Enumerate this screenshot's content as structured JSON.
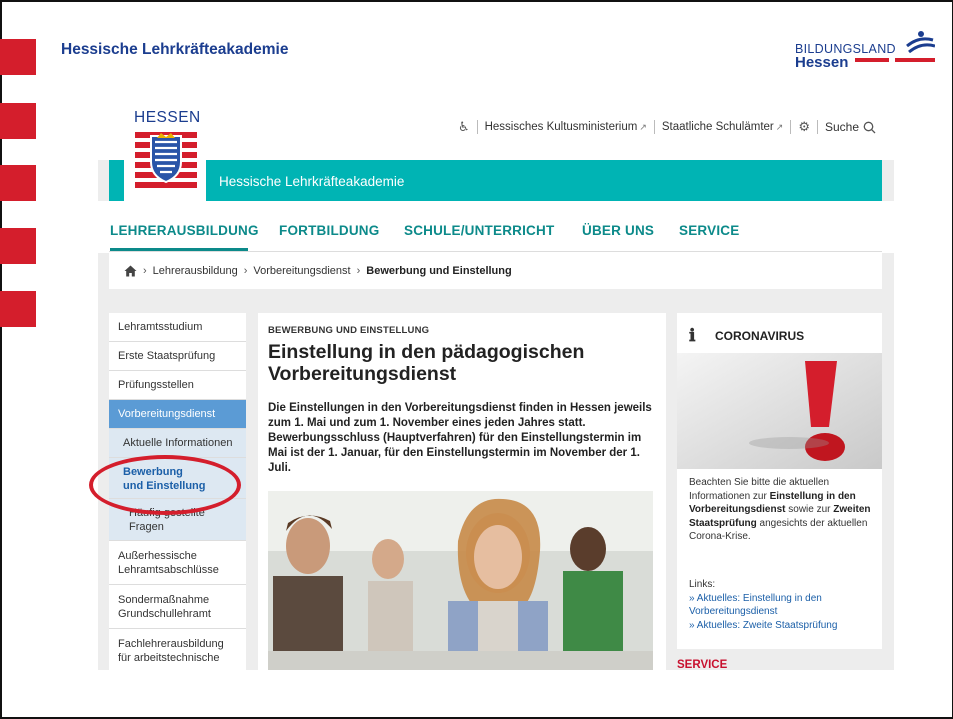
{
  "slide": {
    "title": "Hessische Lehrkräfteakademie",
    "logo": {
      "line1": "BILDUNGSLAND",
      "line2": "Hessen"
    }
  },
  "site": {
    "crest_title": "HESSEN",
    "banner_text": "Hessische Lehrkräfteakademie",
    "utility_links": [
      {
        "label": "Hessisches Kultusministerium",
        "icon": "external-link-icon"
      },
      {
        "label": "Staatliche Schulämter",
        "icon": "external-link-icon"
      }
    ],
    "search_label": "Suche",
    "main_nav": [
      {
        "label": "LEHRERAUSBILDUNG",
        "active": true
      },
      {
        "label": "FORTBILDUNG"
      },
      {
        "label": "SCHULE/UNTERRICHT"
      },
      {
        "label": "ÜBER UNS"
      },
      {
        "label": "SERVICE"
      }
    ],
    "breadcrumb": [
      "Lehrerausbildung",
      "Vorbereitungsdienst",
      "Bewerbung und Einstellung"
    ],
    "sidenav": [
      {
        "label": "Lehramtsstudium"
      },
      {
        "label": "Erste Staatsprüfung"
      },
      {
        "label": "Prüfungsstellen"
      },
      {
        "label": "Vorbereitungsdienst",
        "active": true
      },
      {
        "label": "Aktuelle Informationen"
      },
      {
        "label": "Bewerbung und Einstellung",
        "selected": true
      },
      {
        "label": "Häufig gestellte Fragen"
      },
      {
        "label": "Außerhessische Lehramtsabschlüsse"
      },
      {
        "label": "Sondermaßnahme Grundschullehramt"
      },
      {
        "label": "Fachlehrerausbildung für arbeitstechnische"
      }
    ],
    "content": {
      "kicker": "BEWERBUNG UND EINSTELLUNG",
      "heading": "Einstellung in den pädagogischen Vorbereitungsdienst",
      "lead": "Die Einstellungen in den Vorbereitungsdienst finden in Hessen jeweils zum 1. Mai und zum 1. November eines jeden Jahres statt. Bewerbungsschluss (Hauptverfahren) für den Einstellungstermin im Mai ist der 1. Januar, für den Einstellungstermin im November der 1. Juli."
    },
    "sidebar_box": {
      "title": "CORONAVIRUS",
      "text_1": "Beachten Sie bitte die aktuellen Informationen zur ",
      "text_bold_1": "Einstellung in den Vorbereitungsdienst",
      "text_2": " sowie zur ",
      "text_bold_2": "Zweiten Staatsprüfung",
      "text_3": " angesichts der aktuellen Corona-Krise.",
      "links_label": "Links:",
      "links": [
        "» Aktuelles: Einstellung in den Vorbereitungsdienst",
        "» Aktuelles: Zweite Staatsprüfung"
      ]
    },
    "service_label": "SERVICE"
  },
  "colors": {
    "teal": "#00b4b4",
    "nav_teal": "#0c8a8a",
    "red": "#d41e2c",
    "blue": "#1b3d8f",
    "link": "#1b5fa8"
  }
}
